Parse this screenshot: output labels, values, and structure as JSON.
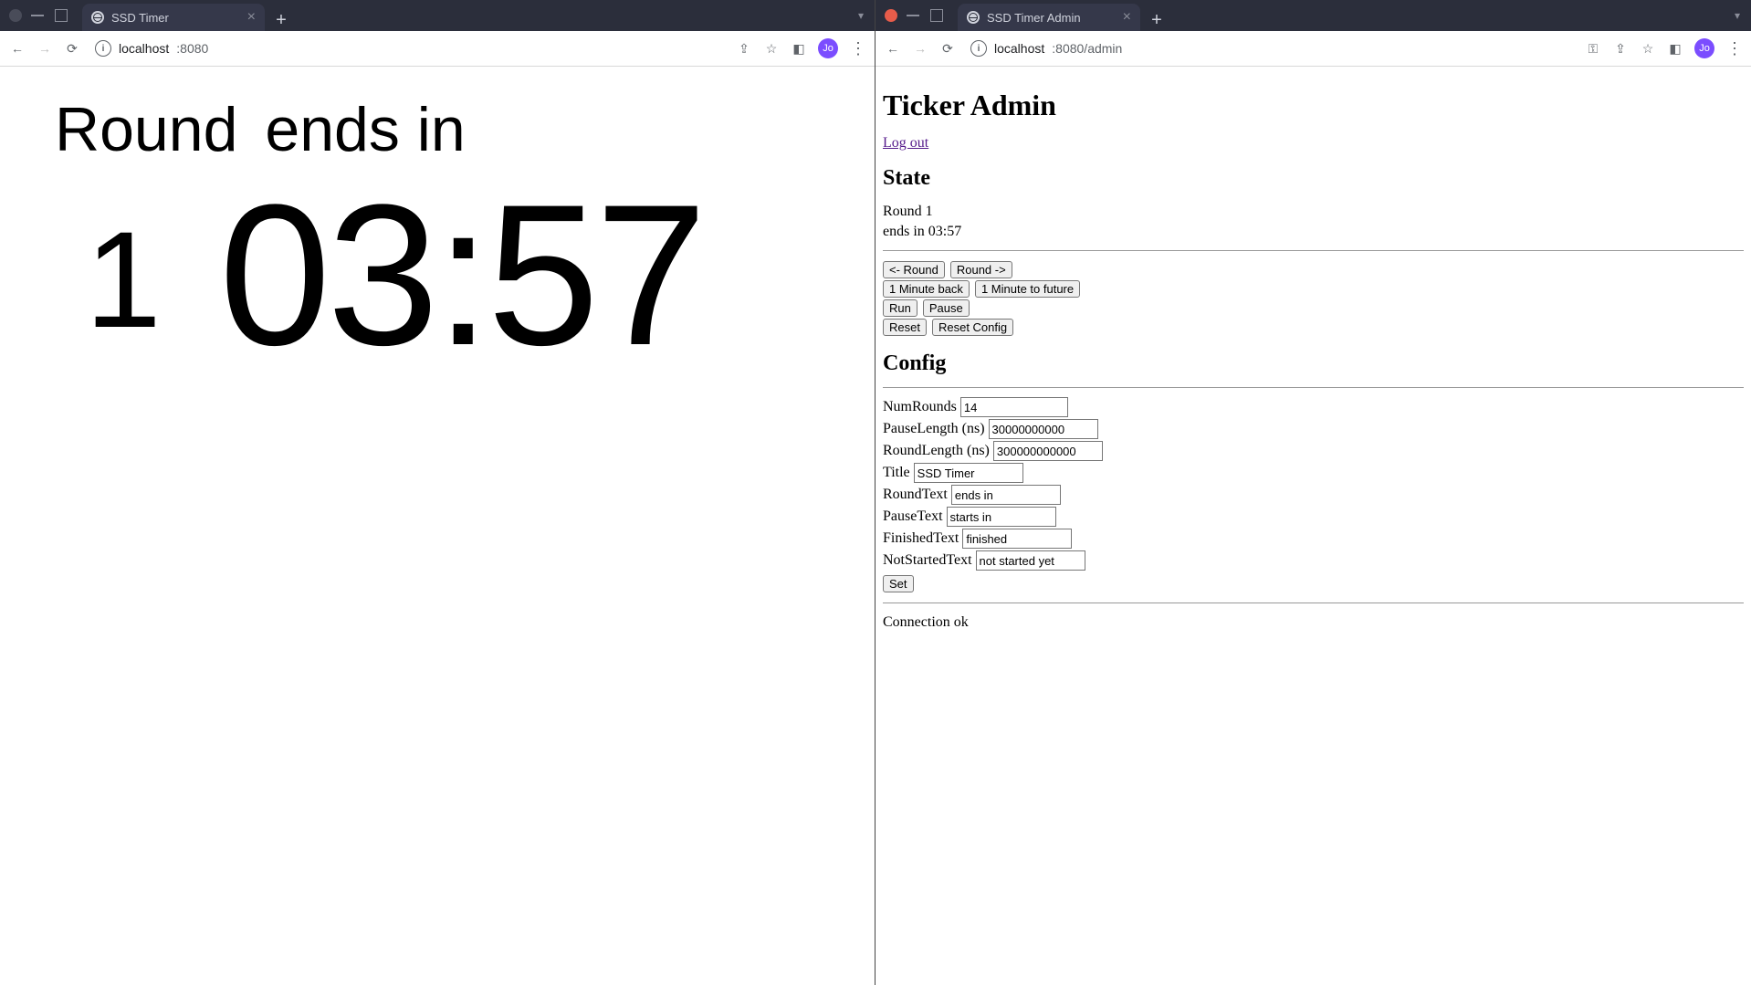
{
  "left": {
    "tab_title": "SSD Timer",
    "url_host": "localhost",
    "url_port": ":8080",
    "avatar": "Jo",
    "timer": {
      "round_label": "Round",
      "status_label": "ends in",
      "round_number": "1",
      "time": "03:57"
    }
  },
  "right": {
    "tab_title": "SSD Timer Admin",
    "url_host": "localhost",
    "url_portpath": ":8080/admin",
    "avatar": "Jo",
    "page_title": "Ticker Admin",
    "logout": "Log out",
    "state_heading": "State",
    "state_round": "Round 1",
    "state_ends": "ends in 03:57",
    "buttons": {
      "round_back": "<- Round",
      "round_fwd": "Round ->",
      "min_back": "1 Minute back",
      "min_fwd": "1 Minute to future",
      "run": "Run",
      "pause": "Pause",
      "reset": "Reset",
      "reset_config": "Reset Config",
      "set": "Set"
    },
    "config_heading": "Config",
    "config": {
      "NumRounds": {
        "label": "NumRounds",
        "value": "14"
      },
      "PauseLength": {
        "label": "PauseLength (ns)",
        "value": "30000000000"
      },
      "RoundLength": {
        "label": "RoundLength (ns)",
        "value": "300000000000"
      },
      "Title": {
        "label": "Title",
        "value": "SSD Timer"
      },
      "RoundText": {
        "label": "RoundText",
        "value": "ends in"
      },
      "PauseText": {
        "label": "PauseText",
        "value": "starts in"
      },
      "FinishedText": {
        "label": "FinishedText",
        "value": "finished"
      },
      "NotStartedText": {
        "label": "NotStartedText",
        "value": "not started yet"
      }
    },
    "connection": "Connection ok"
  }
}
